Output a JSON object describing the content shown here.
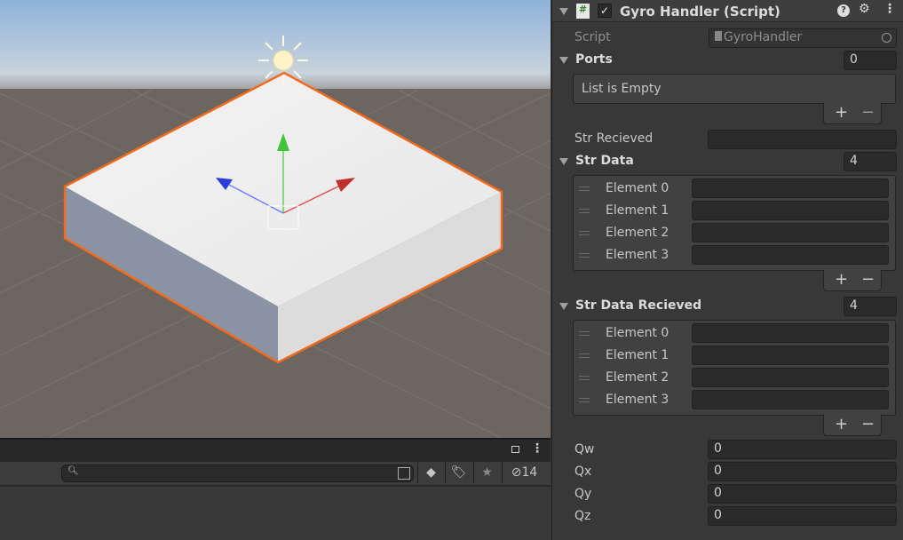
{
  "scene": {
    "colors": {
      "selection": "#f26b1d",
      "sky": "#a9c3df",
      "ground": "#6d6560"
    },
    "icons": [
      "sun-light-icon",
      "transform-gizmo-icon"
    ]
  },
  "project_panel": {
    "search": {
      "value": "",
      "placeholder": ""
    },
    "hidden_count": "14"
  },
  "inspector": {
    "component_title": "Gyro Handler (Script)",
    "enabled": true,
    "script": {
      "label": "Script",
      "value": "GyroHandler"
    },
    "ports": {
      "label": "Ports",
      "size": "0",
      "empty_text": "List is Empty"
    },
    "str_recieved": {
      "label": "Str Recieved",
      "value": ""
    },
    "str_data": {
      "label": "Str Data",
      "size": "4",
      "elements": [
        {
          "label": "Element 0",
          "value": ""
        },
        {
          "label": "Element 1",
          "value": ""
        },
        {
          "label": "Element 2",
          "value": ""
        },
        {
          "label": "Element 3",
          "value": ""
        }
      ]
    },
    "str_data_recieved": {
      "label": "Str Data Recieved",
      "size": "4",
      "elements": [
        {
          "label": "Element 0",
          "value": ""
        },
        {
          "label": "Element 1",
          "value": ""
        },
        {
          "label": "Element 2",
          "value": ""
        },
        {
          "label": "Element 3",
          "value": ""
        }
      ]
    },
    "add_label": "+",
    "remove_label": "−",
    "quaternion": [
      {
        "label": "Qw",
        "value": "0"
      },
      {
        "label": "Qx",
        "value": "0"
      },
      {
        "label": "Qy",
        "value": "0"
      },
      {
        "label": "Qz",
        "value": "0"
      }
    ]
  }
}
